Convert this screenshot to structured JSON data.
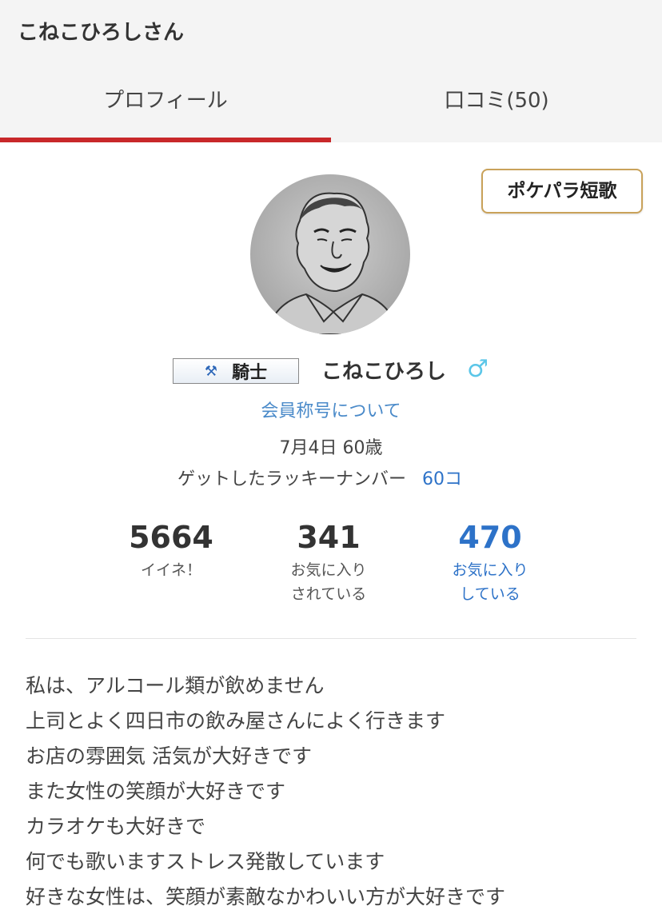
{
  "header": {
    "title": "こねこひろしさん",
    "tabs": [
      {
        "label": "プロフィール",
        "active": true
      },
      {
        "label": "口コミ(50)",
        "active": false
      }
    ]
  },
  "tanka_button": {
    "label": "ポケパラ短歌"
  },
  "profile": {
    "rank_badge": {
      "icon": "crossed-axes-icon",
      "label": "騎士"
    },
    "username": "こねこひろし",
    "gender_icon": "male-icon",
    "gender_symbol": "♂",
    "rank_link": "会員称号について",
    "birth_age": "7月4日 60歳",
    "lucky_label": "ゲットしたラッキーナンバー",
    "lucky_count": "60コ"
  },
  "stats": [
    {
      "value": "5664",
      "label": "イイネ！"
    },
    {
      "value": "341",
      "label": "お気に入り\nされている"
    },
    {
      "value": "470",
      "label": "お気に入り\nしている"
    }
  ],
  "bio": [
    "私は、アルコール類が飲めません",
    "上司とよく四日市の飲み屋さんによく行きます",
    "お店の雰囲気 活気が大好きです",
    "また女性の笑顔が大好きです",
    "カラオケも大好きで",
    "何でも歌いますストレス発散しています",
    "好きな女性は、笑顔が素敵なかわいい方が大好きです"
  ],
  "colors": {
    "accent_red": "#c8282a",
    "link_blue": "#2d72c8",
    "gender_blue": "#5bc6e8",
    "gold_border": "#c9a25a"
  }
}
